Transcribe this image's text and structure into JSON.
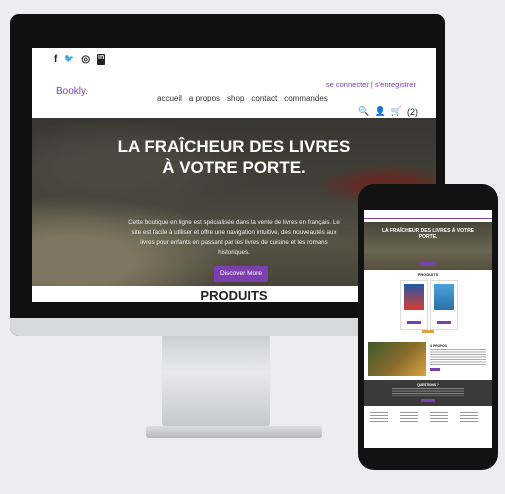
{
  "desktop": {
    "social_icons": [
      "facebook-icon",
      "twitter-icon",
      "instagram-icon",
      "linkedin-icon"
    ],
    "social_glyphs": [
      "f",
      "🐦",
      "◎",
      "in"
    ],
    "auth": {
      "login": "se connecter",
      "separator": "|",
      "register": "s'enregistrer"
    },
    "logo": "Bookly.",
    "nav": [
      "accueil",
      "a propos",
      "shop",
      "contact",
      "commandes"
    ],
    "cart_count": "(2)",
    "hero": {
      "title": "LA FRAÎCHEUR DES LIVRES À VOTRE PORTE.",
      "text": "Cette boutique en ligne est spécialisée dans la vente de livres en français. Le site est facile à utiliser et offre une navigation intuitive, des nouveautés aux livres pour enfants en passant par les livres de cuisine et les romans historiques.",
      "button": "Discover More"
    },
    "products_heading": "PRODUITS"
  },
  "phone": {
    "hero_title": "LA FRAÎCHEUR DES LIVRES À VOTRE PORTE.",
    "products_heading": "PRODUITS",
    "about_heading": "À PROPOS",
    "questions_heading": "QUESTIONS ?"
  },
  "colors": {
    "accent": "#7b3fb0",
    "background": "#ededf0"
  }
}
